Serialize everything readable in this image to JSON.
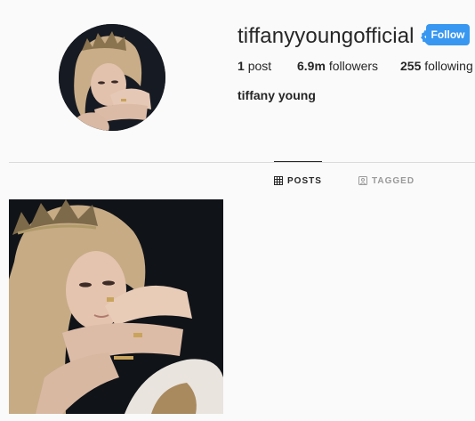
{
  "profile": {
    "username": "tiffanyyoungofficial",
    "verified": true,
    "follow_label": "Follow",
    "full_name": "tiffany young"
  },
  "stats": {
    "posts_count": "1",
    "posts_label": "post",
    "followers_count": "6.9m",
    "followers_label": "followers",
    "following_count": "255",
    "following_label": "following"
  },
  "tabs": [
    {
      "label": "POSTS",
      "icon": "grid-icon",
      "active": true
    },
    {
      "label": "TAGGED",
      "icon": "tagged-icon",
      "active": false
    }
  ],
  "colors": {
    "accent": "#3897f0",
    "background": "#fafafa",
    "text": "#262626",
    "muted": "#999999",
    "divider": "#dbdbdb"
  },
  "posts": [
    {
      "type": "photo",
      "description_icon": "photo-thumbnail"
    }
  ]
}
